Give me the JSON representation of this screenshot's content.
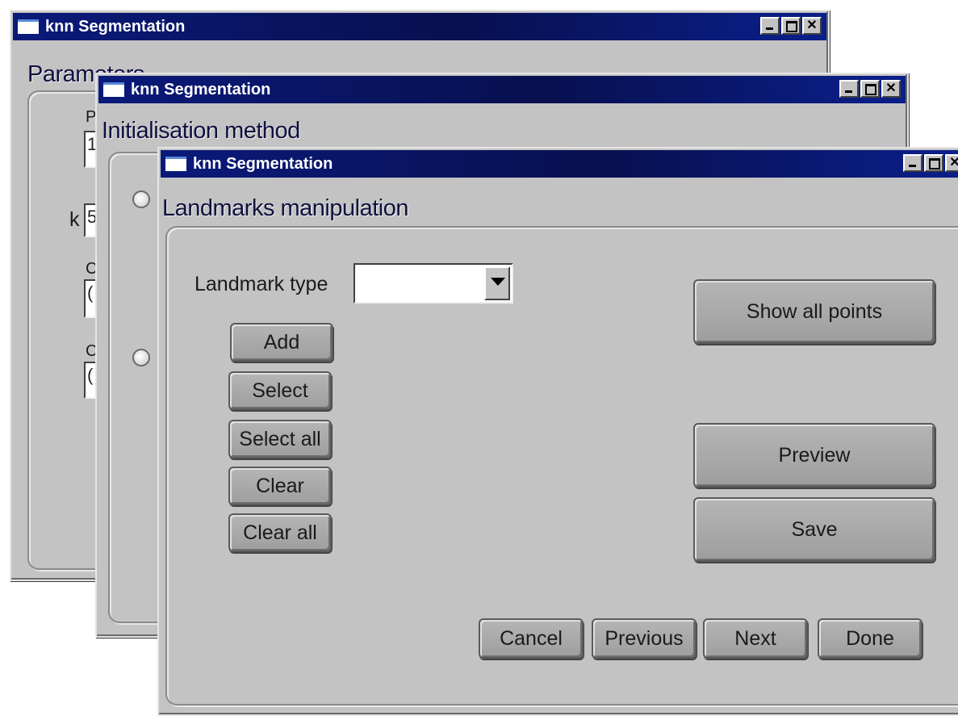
{
  "windows": {
    "back": {
      "title": "knn Segmentation",
      "section_title": "Parameters",
      "labels": [
        "P",
        "k",
        "C",
        "C"
      ],
      "field_values": [
        "1",
        "5",
        "(",
        "("
      ]
    },
    "middle": {
      "title": "knn Segmentation",
      "section_title": "Initialisation method"
    },
    "front": {
      "title": "knn Segmentation",
      "section_title": "Landmarks manipulation",
      "landmark_type_label": "Landmark type",
      "landmark_type_value": "",
      "buttons": {
        "add": "Add",
        "select": "Select",
        "select_all": "Select all",
        "clear": "Clear",
        "clear_all": "Clear all",
        "show_all_points": "Show all points",
        "preview": "Preview",
        "save": "Save",
        "cancel": "Cancel",
        "previous": "Previous",
        "next": "Next",
        "done": "Done"
      }
    }
  },
  "window_controls": {
    "minimize": "_",
    "maximize": "□",
    "close": "✕"
  }
}
